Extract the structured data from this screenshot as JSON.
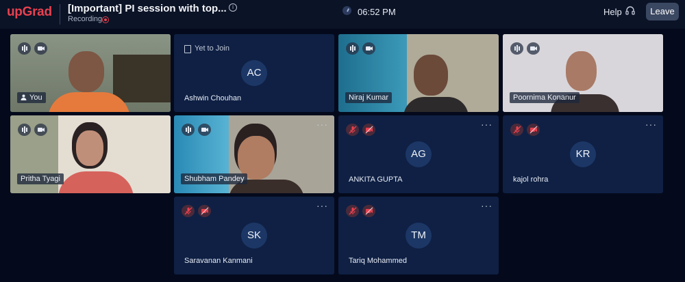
{
  "header": {
    "logo": "upGrad",
    "title": "[Important] PI session with top...",
    "info_icon": "info-icon",
    "recording_label": "Recording",
    "time": "06:52 PM",
    "help_label": "Help",
    "leave_label": "Leave"
  },
  "colors": {
    "brand": "#e8414f",
    "background": "#040a1c",
    "tile": "#0f2044",
    "avatar": "#1c3766"
  },
  "participants": [
    {
      "name": "You",
      "video": true,
      "muted": false
    },
    {
      "name": "Ashwin Chouhan",
      "status": "Yet to Join",
      "initials": "AC"
    },
    {
      "name": "Niraj Kumar",
      "video": true,
      "muted": false
    },
    {
      "name": "Poornima Konanur",
      "video": true,
      "muted": false
    },
    {
      "name": "Pritha Tyagi",
      "video": true,
      "muted": false
    },
    {
      "name": "Shubham Pandey",
      "video": true,
      "muted": false
    },
    {
      "name": "ANKITA GUPTA",
      "initials": "AG",
      "video": false,
      "muted": true
    },
    {
      "name": "kajol rohra",
      "initials": "KR",
      "video": false,
      "muted": true
    },
    {
      "name": "Saravanan Kanmani",
      "initials": "SK",
      "video": false,
      "muted": true
    },
    {
      "name": "Tariq Mohammed",
      "initials": "TM",
      "video": false,
      "muted": true
    }
  ],
  "more_glyph": "···"
}
